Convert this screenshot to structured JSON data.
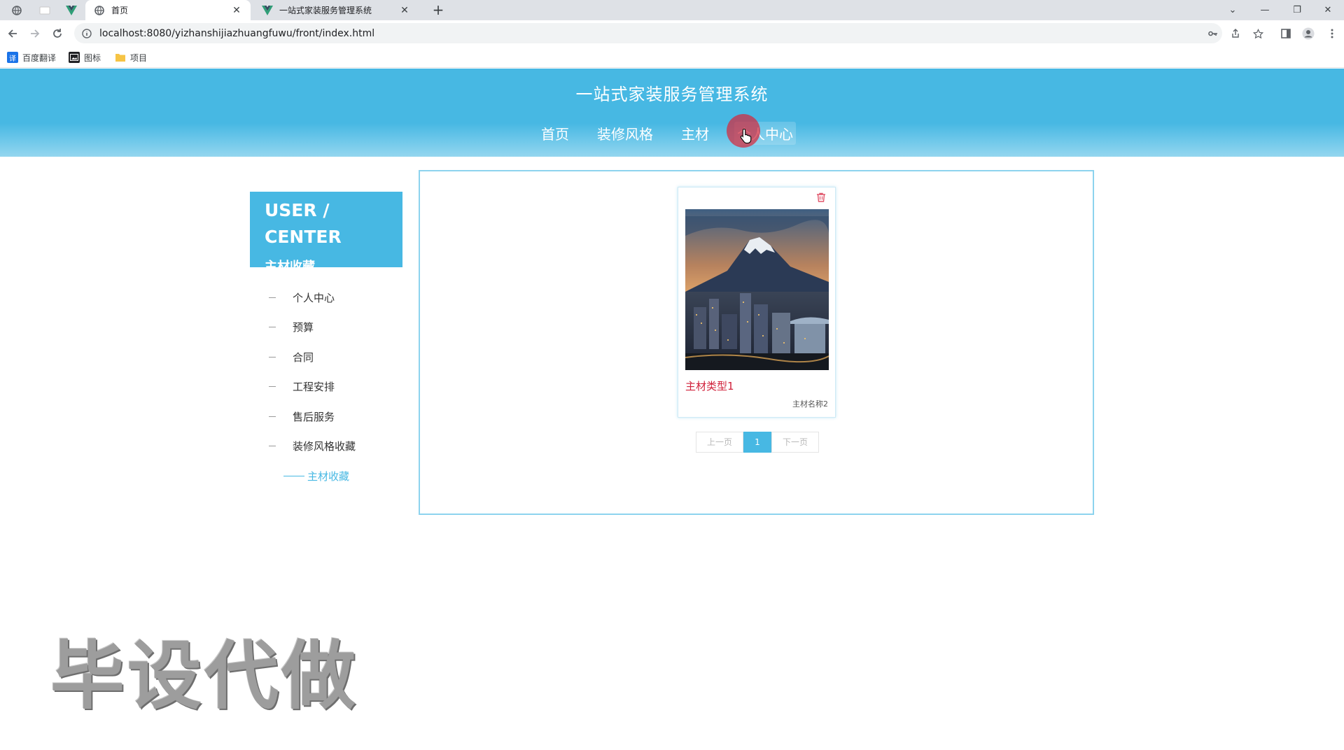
{
  "browser": {
    "tabs": [
      {
        "title": "首页",
        "favicon": "globe-icon",
        "active": true
      },
      {
        "title": "一站式家装服务管理系统",
        "favicon": "vue-logo-icon",
        "active": false
      }
    ],
    "url": "localhost:8080/yizhanshijiazhuangfuwu/front/index.html",
    "bookmarks": [
      {
        "label": "百度翻译",
        "icon": "translate-icon",
        "color": "#1a73e8"
      },
      {
        "label": "图标",
        "icon": "image-icon",
        "color": "#202124"
      },
      {
        "label": "项目",
        "icon": "folder-icon",
        "color": "#f6c445"
      }
    ]
  },
  "header": {
    "title": "一站式家装服务管理系统",
    "nav": [
      {
        "label": "首页"
      },
      {
        "label": "装修风格"
      },
      {
        "label": "主材"
      },
      {
        "label": "个人中心"
      }
    ]
  },
  "sidebar": {
    "heading_en": "USER / CENTER",
    "heading_cn": "主材收藏",
    "items": [
      {
        "label": "个人中心"
      },
      {
        "label": "预算"
      },
      {
        "label": "合同"
      },
      {
        "label": "工程安排"
      },
      {
        "label": "售后服务"
      },
      {
        "label": "装修风格收藏"
      },
      {
        "label": "主材收藏",
        "active": true
      }
    ]
  },
  "content": {
    "cards": [
      {
        "title": "主材类型1",
        "subtitle": "主材名称2"
      }
    ],
    "pager": {
      "prev": "上一页",
      "current": "1",
      "next": "下一页"
    }
  },
  "watermark": "毕设代做",
  "colors": {
    "accent": "#47b8e3",
    "card_title": "#d0203a"
  }
}
